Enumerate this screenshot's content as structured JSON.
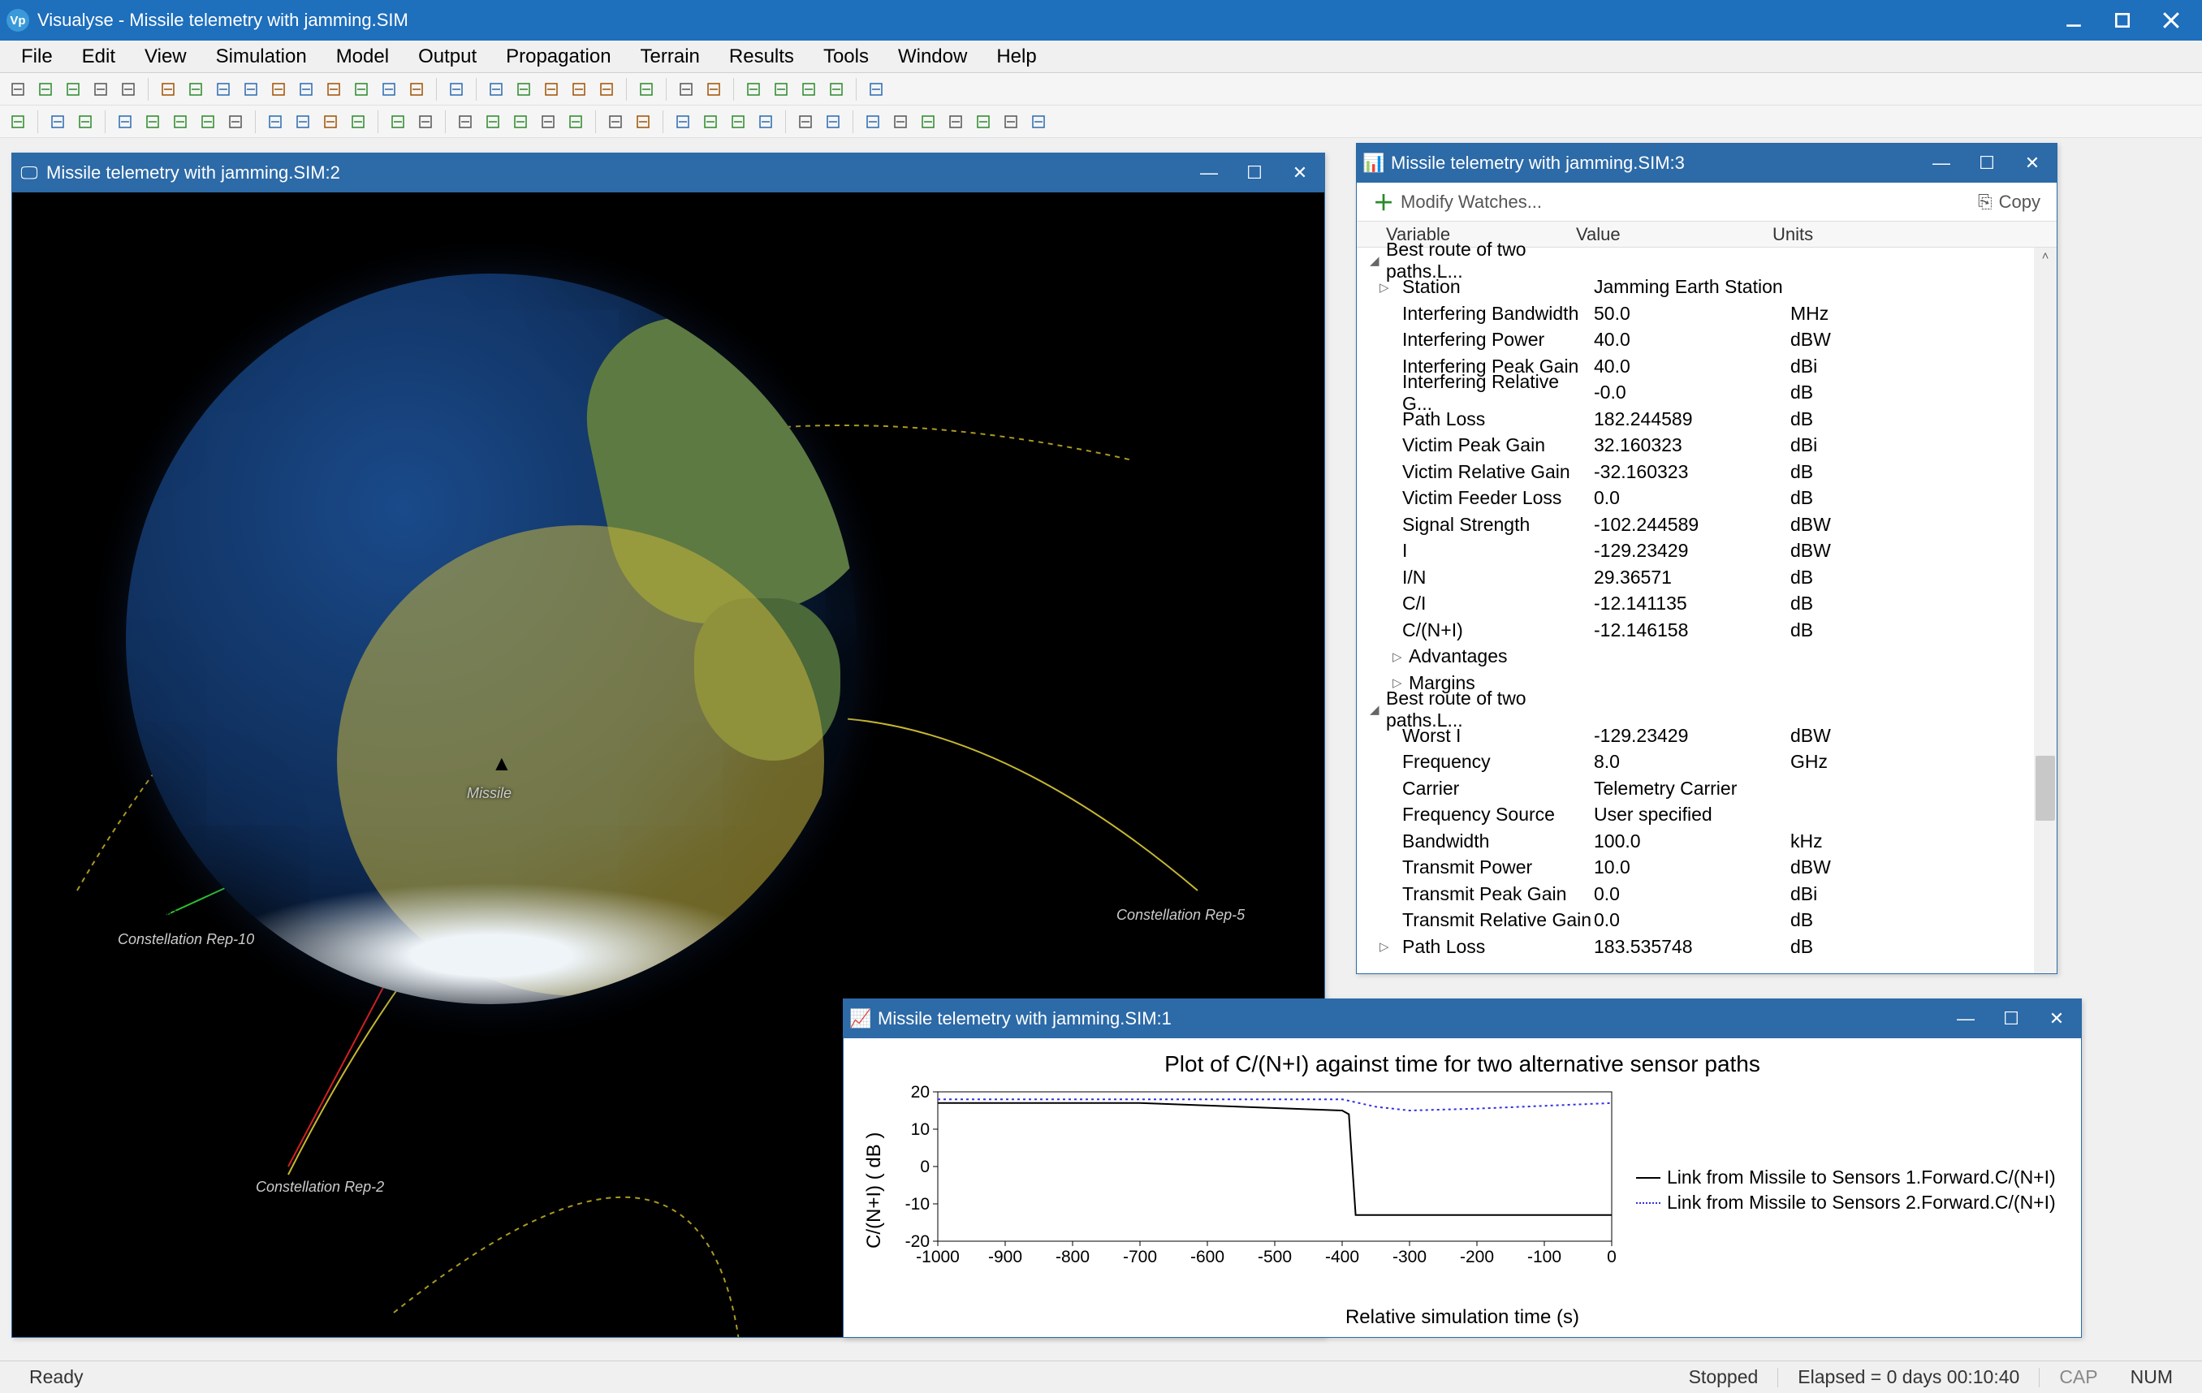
{
  "app": {
    "title": "Visualyse - Missile telemetry with jamming.SIM"
  },
  "menu": [
    "File",
    "Edit",
    "View",
    "Simulation",
    "Model",
    "Output",
    "Propagation",
    "Terrain",
    "Results",
    "Tools",
    "Window",
    "Help"
  ],
  "childWindows": {
    "view3d": {
      "title": "Missile telemetry with jamming.SIM:2"
    },
    "watch": {
      "title": "Missile telemetry with jamming.SIM:3"
    },
    "chart": {
      "title": "Missile telemetry with jamming.SIM:1"
    }
  },
  "view3d_labels": {
    "missile": "Missile",
    "rep10": "Constellation Rep-10",
    "rep5": "Constellation Rep-5",
    "rep2": "Constellation Rep-2"
  },
  "watch": {
    "modify": "Modify Watches...",
    "copy": "Copy",
    "headers": {
      "variable": "Variable",
      "value": "Value",
      "units": "Units"
    },
    "group1": "Best route of two paths.L...",
    "rows1": [
      {
        "v": "Station",
        "val": "Jamming Earth Station",
        "u": ""
      },
      {
        "v": "Interfering Bandwidth",
        "val": "50.0",
        "u": "MHz"
      },
      {
        "v": "Interfering Power",
        "val": "40.0",
        "u": "dBW"
      },
      {
        "v": "Interfering Peak Gain",
        "val": "40.0",
        "u": "dBi"
      },
      {
        "v": "Interfering Relative G...",
        "val": "-0.0",
        "u": "dB"
      },
      {
        "v": "Path Loss",
        "val": "182.244589",
        "u": "dB"
      },
      {
        "v": "Victim Peak Gain",
        "val": "32.160323",
        "u": "dBi"
      },
      {
        "v": "Victim Relative Gain",
        "val": "-32.160323",
        "u": "dB"
      },
      {
        "v": "Victim Feeder Loss",
        "val": "0.0",
        "u": "dB"
      },
      {
        "v": "Signal Strength",
        "val": "-102.244589",
        "u": "dBW"
      },
      {
        "v": "I",
        "val": "-129.23429",
        "u": "dBW"
      },
      {
        "v": "I/N",
        "val": "29.36571",
        "u": "dB"
      },
      {
        "v": "C/I",
        "val": "-12.141135",
        "u": "dB"
      },
      {
        "v": "C/(N+I)",
        "val": "-12.146158",
        "u": "dB"
      }
    ],
    "sub1": "Advantages",
    "sub2": "Margins",
    "group2": "Best route of two paths.L...",
    "rows2": [
      {
        "v": "Worst I",
        "val": "-129.23429",
        "u": "dBW"
      },
      {
        "v": "Frequency",
        "val": "8.0",
        "u": "GHz"
      },
      {
        "v": "Carrier",
        "val": "Telemetry Carrier",
        "u": ""
      },
      {
        "v": "Frequency Source",
        "val": "User specified",
        "u": ""
      },
      {
        "v": "Bandwidth",
        "val": "100.0",
        "u": "kHz"
      },
      {
        "v": "Transmit Power",
        "val": "10.0",
        "u": "dBW"
      },
      {
        "v": "Transmit Peak Gain",
        "val": "0.0",
        "u": "dBi"
      },
      {
        "v": "Transmit Relative Gain",
        "val": "0.0",
        "u": "dB"
      },
      {
        "v": "Path Loss",
        "val": "183.535748",
        "u": "dB"
      }
    ]
  },
  "chart_data": {
    "type": "line",
    "title": "Plot of C/(N+I) against time for two alternative sensor paths",
    "xlabel": "Relative simulation time (s)",
    "ylabel": "C/(N+I) ( dB )",
    "x_ticks": [
      -1000,
      -900,
      -800,
      -700,
      -600,
      -500,
      -400,
      -300,
      -200,
      -100,
      0
    ],
    "y_ticks": [
      -20,
      -10,
      0,
      10,
      20
    ],
    "xlim": [
      -1000,
      0
    ],
    "ylim": [
      -20,
      20
    ],
    "series": [
      {
        "name": "Link from Missile to Sensors 1.Forward.C/(N+I)",
        "color": "#000000",
        "style": "solid",
        "x": [
          -1000,
          -700,
          -400,
          -390,
          -380,
          -200,
          0
        ],
        "y": [
          17,
          17,
          15,
          14,
          -13,
          -13,
          -13
        ]
      },
      {
        "name": "Link from Missile to Sensors 2.Forward.C/(N+I)",
        "color": "#3030e0",
        "style": "dotted",
        "x": [
          -1000,
          -400,
          -350,
          -300,
          -200,
          0
        ],
        "y": [
          18,
          18,
          16,
          15,
          15.5,
          17
        ]
      }
    ]
  },
  "status": {
    "ready": "Ready",
    "stopped": "Stopped",
    "elapsed": "Elapsed = 0 days 00:10:40",
    "cap": "CAP",
    "num": "NUM"
  }
}
